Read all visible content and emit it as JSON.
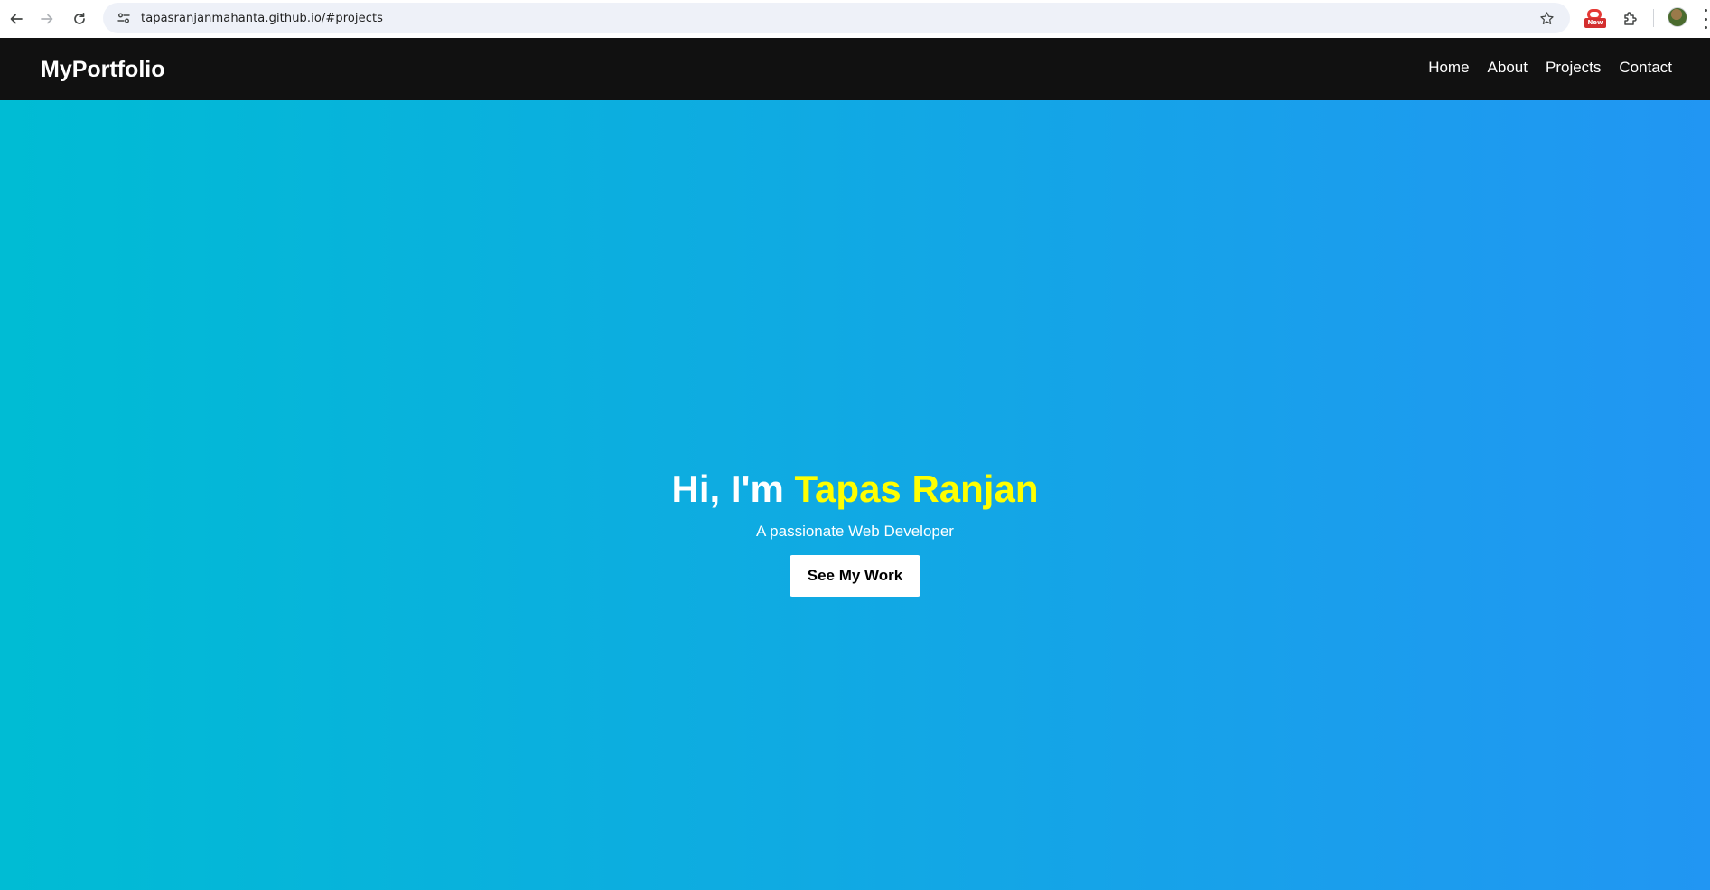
{
  "browser": {
    "url": "tapasranjanmahanta.github.io/#projects",
    "extension_badge": "New",
    "icons": [
      "back-arrow-icon",
      "forward-arrow-icon",
      "reload-icon",
      "site-info-icon",
      "bookmark-star-icon",
      "extension-icon",
      "puzzle-icon",
      "profile-avatar",
      "more-menu-icon"
    ]
  },
  "header": {
    "logo": "MyPortfolio",
    "nav": [
      "Home",
      "About",
      "Projects",
      "Contact"
    ]
  },
  "hero": {
    "greeting": "Hi, I'm ",
    "name": "Tapas Ranjan",
    "subtitle": "A passionate Web Developer",
    "cta": "See My Work"
  },
  "colors": {
    "header_bg": "#111111",
    "hero_gradient_start": "#00bcd4",
    "hero_gradient_end": "#2196f3",
    "name_highlight": "#ffff00",
    "button_bg": "#ffffff"
  }
}
